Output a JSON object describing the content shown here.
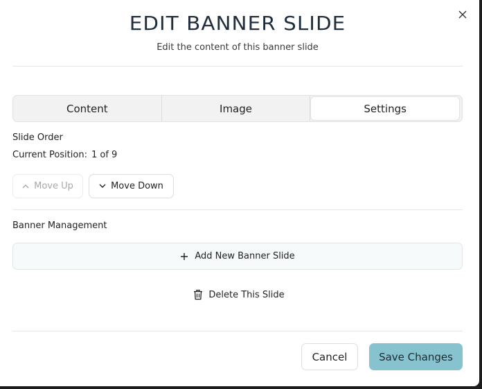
{
  "dialog": {
    "title": "EDIT BANNER SLIDE",
    "subtitle": "Edit the content of this banner slide"
  },
  "tabs": [
    {
      "label": "Content",
      "active": false
    },
    {
      "label": "Image",
      "active": false
    },
    {
      "label": "Settings",
      "active": true
    }
  ],
  "slide_order": {
    "heading": "Slide Order",
    "position_label": "Current Position:",
    "position_value": "1 of 9",
    "move_up_label": "Move Up",
    "move_down_label": "Move Down"
  },
  "banner_management": {
    "heading": "Banner Management",
    "add_label": "Add New Banner Slide",
    "delete_label": "Delete This Slide"
  },
  "footer": {
    "cancel_label": "Cancel",
    "save_label": "Save Changes"
  },
  "colors": {
    "accent": "#86c3cf",
    "title": "#1f2d3d"
  }
}
